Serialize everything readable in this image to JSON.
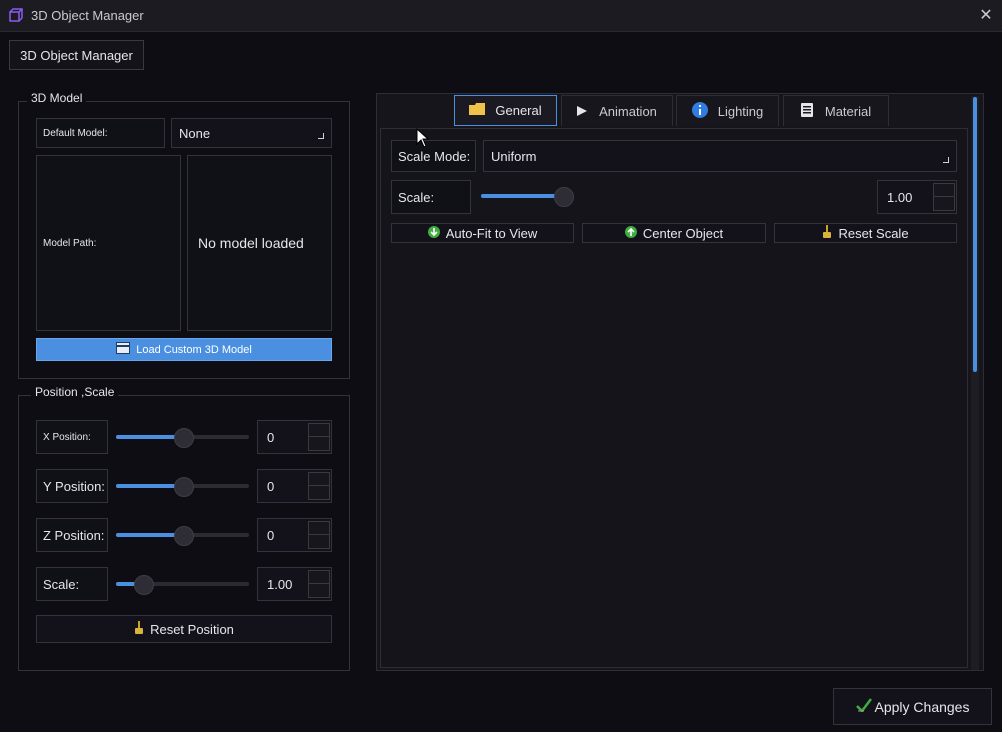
{
  "window": {
    "title": "3D Object Manager",
    "app_icon": "cube-icon",
    "close_glyph": "✕"
  },
  "toolbar": {
    "manager_button": "3D Object Manager"
  },
  "model_group": {
    "title": "3D Model",
    "default_model_label": "Default Model:",
    "default_model_value": "None",
    "model_path_label": "Model Path:",
    "model_status": "No model loaded",
    "load_button": "Load Custom 3D Model",
    "load_icon": "folder-icon"
  },
  "position_group": {
    "title": "Position ,Scale",
    "rows": [
      {
        "label": "X Position:",
        "value": "0",
        "slider": 0.5
      },
      {
        "label": "Y Position:",
        "value": "0",
        "slider": 0.5
      },
      {
        "label": "Z Position:",
        "value": "0",
        "slider": 0.5
      },
      {
        "label": "Scale:",
        "value": "1.00",
        "slider": 0.2
      }
    ],
    "reset_button": "Reset Position",
    "reset_icon": "broom-icon"
  },
  "tabs": [
    {
      "label": "General",
      "icon": "folder-icon",
      "active": true
    },
    {
      "label": "Animation",
      "icon": "play-icon",
      "active": false
    },
    {
      "label": "Lighting",
      "icon": "info-icon",
      "active": false
    },
    {
      "label": "Material",
      "icon": "document-icon",
      "active": false
    }
  ],
  "general": {
    "scale_mode_label": "Scale Mode:",
    "scale_mode_value": "Uniform",
    "scale_label": "Scale:",
    "scale_value": "1.00",
    "scale_slider": 0.95,
    "buttons": [
      {
        "label": "Auto-Fit to View",
        "icon": "arrow-down-circle-icon"
      },
      {
        "label": "Center Object",
        "icon": "arrow-up-circle-icon"
      },
      {
        "label": "Reset Scale",
        "icon": "broom-icon"
      }
    ]
  },
  "footer": {
    "apply_button": "Apply Changes",
    "apply_icon": "checkmark-icon"
  },
  "colors": {
    "accent": "#4a8fe0",
    "background": "#0e0d13",
    "success": "#3fae3f"
  }
}
